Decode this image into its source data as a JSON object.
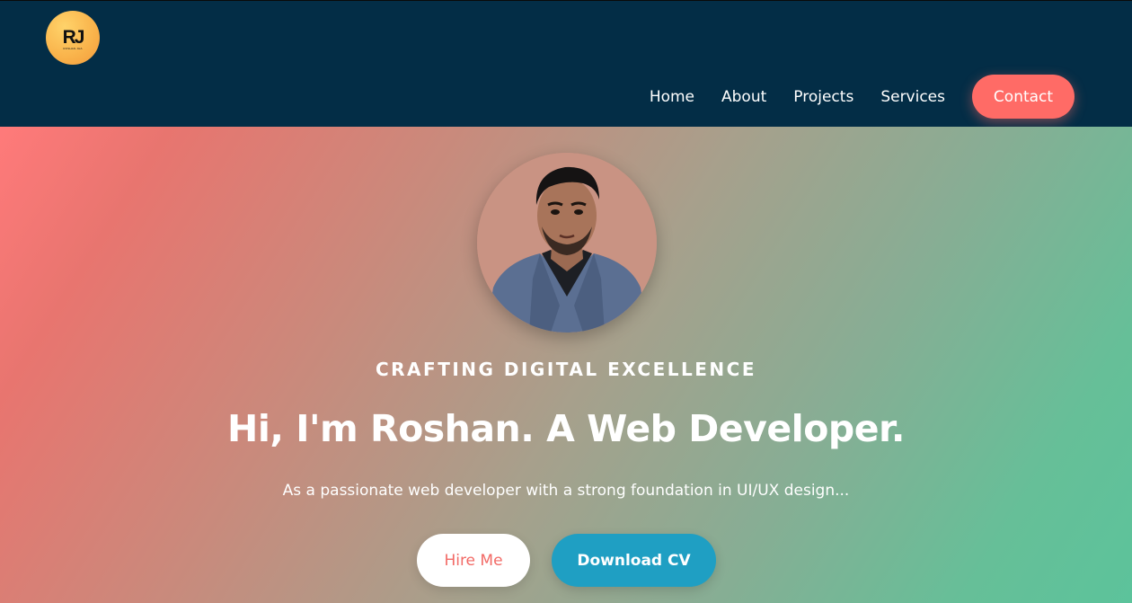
{
  "brand": {
    "logo_mark": "RJ",
    "logo_sub": "ROSHAN JHA"
  },
  "nav": {
    "items": [
      {
        "label": "Home"
      },
      {
        "label": "About"
      },
      {
        "label": "Projects"
      },
      {
        "label": "Services"
      }
    ],
    "contact_label": "Contact"
  },
  "hero": {
    "eyebrow": "CRAFTING DIGITAL EXCELLENCE",
    "headline": "Hi, I'm Roshan. A Web Developer.",
    "tagline": "As a passionate web developer with a strong foundation in UI/UX design...",
    "hire_label": "Hire Me",
    "cv_label": "Download CV"
  },
  "colors": {
    "header_bg": "#032d46",
    "accent_coral": "#ff6b66",
    "accent_blue": "#1f9fc3",
    "gradient_start": "#ff7a7a",
    "gradient_end": "#5cc39b"
  },
  "icons": {
    "logo": "rj-logo-icon",
    "portrait": "profile-portrait"
  }
}
